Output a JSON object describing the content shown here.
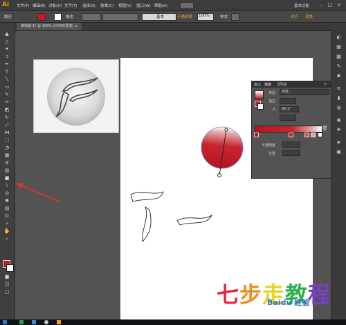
{
  "app": {
    "logo": "Ai"
  },
  "menubar": {
    "items": [
      "文件(F)",
      "编辑(E)",
      "对象(O)",
      "文字(T)",
      "选择(S)",
      "效果(C)",
      "视图(V)",
      "窗口(W)",
      "帮助(H)"
    ],
    "workspace": "基本功能"
  },
  "controlbar": {
    "selection": "路径",
    "stroke_label": "描边",
    "style_label": "基本",
    "opacity_label": "不透明度",
    "opacity_value": "100%",
    "style2_label": "样式",
    "align_label": "对齐",
    "transform_label": "变换"
  },
  "tab": {
    "title": "未标题-1* @ 100% (CMYK/预览)"
  },
  "gradient_panel": {
    "tabs": [
      "描边",
      "渐变",
      "透明度"
    ],
    "type_label": "类型",
    "type_value": "线性",
    "stroke_label": "描边",
    "angle_value": "80.1°",
    "opacity_label": "不透明度",
    "position_label": "位置"
  },
  "watermark": {
    "chars": [
      "七",
      "步",
      "走",
      "教",
      "程"
    ],
    "colors": [
      "#e8273d",
      "#f08a1c",
      "#e8d21a",
      "#28b34a",
      "#7a3fc7"
    ],
    "site": "Baidu 经验"
  },
  "colors": {
    "gradient_start": "#c41a24",
    "gradient_end": "#ffffff",
    "ui_bg": "#535353",
    "arrow": "#e03030"
  }
}
